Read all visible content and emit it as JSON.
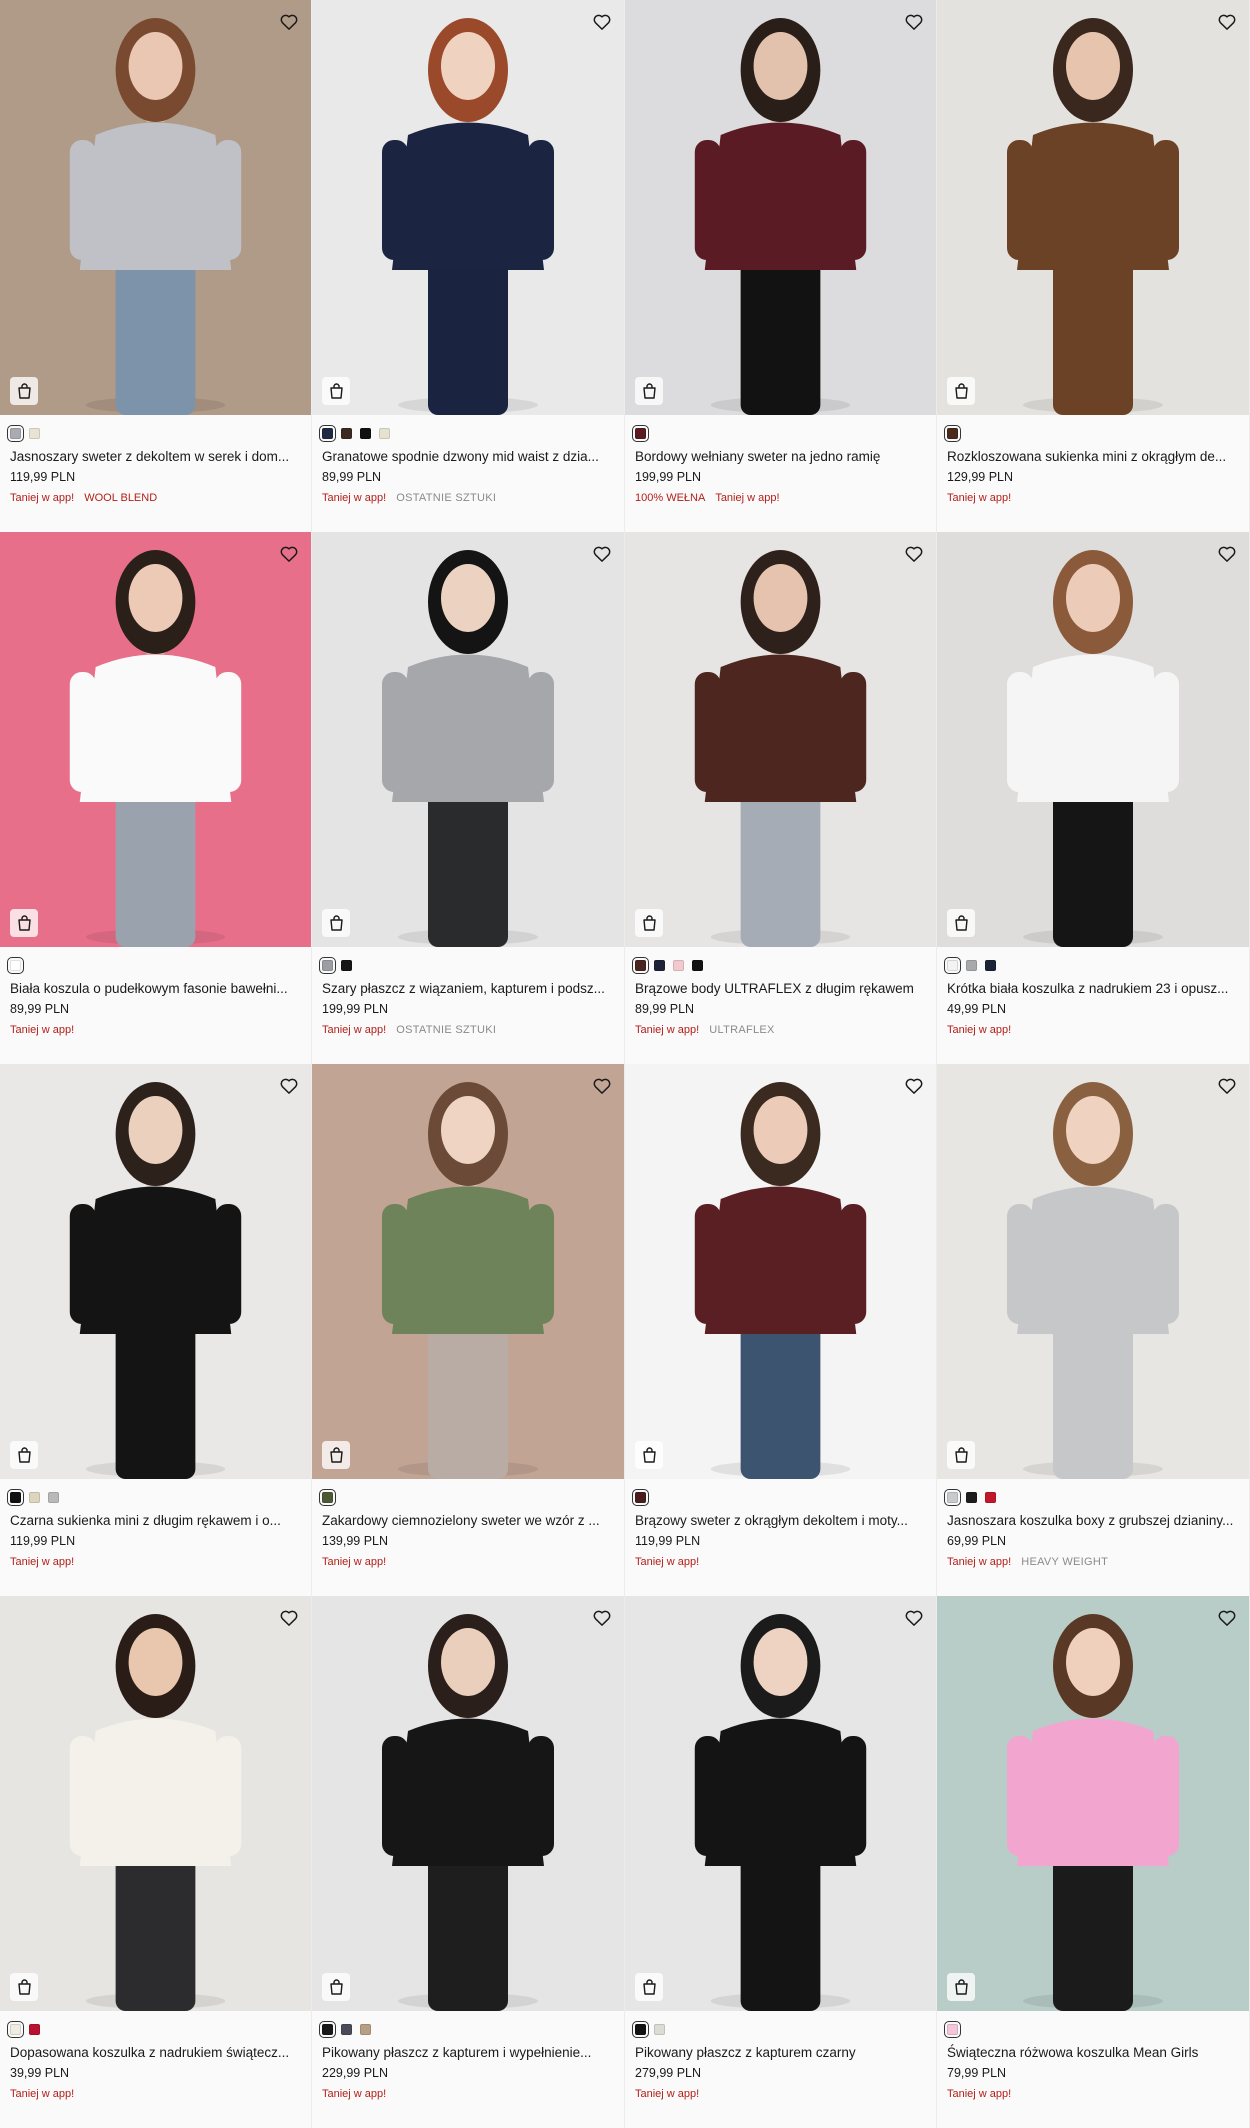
{
  "products": [
    {
      "name": "Jasnoszary sweter z dekoltem w serek i dom...",
      "price": "119,99 PLN",
      "tags": [
        {
          "text": "Taniej w app!",
          "style": "red"
        },
        {
          "text": "WOOL BLEND",
          "style": "red"
        }
      ],
      "swatches": [
        "#a9abb1",
        "#e8e3d3"
      ],
      "bg": "#b09a88",
      "top": "#bfc1c6",
      "bottom": "#7d93aa",
      "skin": "#e9c7b3",
      "hair": "#7a4a30"
    },
    {
      "name": "Granatowe spodnie dzwony mid waist z dzia...",
      "price": "89,99 PLN",
      "tags": [
        {
          "text": "Taniej w app!",
          "style": "red"
        },
        {
          "text": "OSTATNIE SZTUKI",
          "style": "grey"
        }
      ],
      "swatches": [
        "#1f2a44",
        "#3b2a22",
        "#111111",
        "#e6e2d0"
      ],
      "bg": "#e9e9ea",
      "top": "#1b2440",
      "bottom": "#1a2440",
      "skin": "#f0d2c0",
      "hair": "#9a4a2b"
    },
    {
      "name": "Bordowy wełniany sweter na jedno ramię",
      "price": "199,99 PLN",
      "tags": [
        {
          "text": "100% WEŁNA",
          "style": "red"
        },
        {
          "text": "Taniej w app!",
          "style": "red"
        }
      ],
      "swatches": [
        "#5a1a22"
      ],
      "bg": "#dcdcde",
      "top": "#5b1b24",
      "bottom": "#121212",
      "skin": "#e3c2ad",
      "hair": "#2a1e19"
    },
    {
      "name": "Rozkloszowana sukienka mini z okrągłym de...",
      "price": "129,99 PLN",
      "tags": [
        {
          "text": "Taniej w app!",
          "style": "red"
        }
      ],
      "swatches": [
        "#4a2a18"
      ],
      "bg": "#e3e2df",
      "top": "#6b4226",
      "bottom": "#6b4226",
      "skin": "#e6c4ae",
      "hair": "#3a271d"
    },
    {
      "name": "Biała koszula o pudełkowym fasonie bawełni...",
      "price": "89,99 PLN",
      "tags": [
        {
          "text": "Taniej w app!",
          "style": "red"
        }
      ],
      "swatches": [
        "#ffffff"
      ],
      "bg": "#e86f8a",
      "top": "#fafafa",
      "bottom": "#9aa3ad",
      "skin": "#eccab6",
      "hair": "#2b1f1a"
    },
    {
      "name": "Szary płaszcz z wiązaniem, kapturem i podsz...",
      "price": "199,99 PLN",
      "tags": [
        {
          "text": "Taniej w app!",
          "style": "red"
        },
        {
          "text": "OSTATNIE SZTUKI",
          "style": "grey"
        }
      ],
      "swatches": [
        "#9c9ea3",
        "#151515"
      ],
      "bg": "#e4e4e5",
      "top": "#a5a7ab",
      "bottom": "#2a2b2d",
      "skin": "#ecd2c0",
      "hair": "#141414"
    },
    {
      "name": "Brązowe body ULTRAFLEX z długim rękawem",
      "price": "89,99 PLN",
      "tags": [
        {
          "text": "Taniej w app!",
          "style": "red"
        },
        {
          "text": "ULTRAFLEX",
          "style": "grey"
        }
      ],
      "swatches": [
        "#4a2520",
        "#1e2238",
        "#f2c9cf",
        "#121212"
      ],
      "bg": "#e6e5e3",
      "top": "#4c261f",
      "bottom": "#a6acb5",
      "skin": "#e5c3ae",
      "hair": "#2e211b"
    },
    {
      "name": "Krótka biała koszulka z nadrukiem 23 i opusz...",
      "price": "49,99 PLN",
      "tags": [
        {
          "text": "Taniej w app!",
          "style": "red"
        }
      ],
      "swatches": [
        "#f3f3f3",
        "#a7a9aa",
        "#1b2436"
      ],
      "bg": "#dedddb",
      "top": "#f5f5f5",
      "bottom": "#151515",
      "skin": "#ecccb8",
      "hair": "#8a5a3a"
    },
    {
      "name": "Czarna sukienka mini z długim rękawem i o...",
      "price": "119,99 PLN",
      "tags": [
        {
          "text": "Taniej w app!",
          "style": "red"
        }
      ],
      "swatches": [
        "#111111",
        "#ddd5be",
        "#b9b9b9"
      ],
      "bg": "#e9e8e6",
      "top": "#141414",
      "bottom": "#141414",
      "skin": "#ecd0be",
      "hair": "#2d211b"
    },
    {
      "name": "Zakardowy ciemnozielony sweter we wzór z ...",
      "price": "139,99 PLN",
      "tags": [
        {
          "text": "Taniej w app!",
          "style": "red"
        }
      ],
      "swatches": [
        "#4e5a34"
      ],
      "bg": "#c2a494",
      "top": "#6e835a",
      "bottom": "#b9aca4",
      "skin": "#efd3c3",
      "hair": "#6b4a38"
    },
    {
      "name": "Brązowy sweter z okrągłym dekoltem i moty...",
      "price": "119,99 PLN",
      "tags": [
        {
          "text": "Taniej w app!",
          "style": "red"
        }
      ],
      "swatches": [
        "#4a1e1e"
      ],
      "bg": "#f4f4f4",
      "top": "#5a1f22",
      "bottom": "#3d5470",
      "skin": "#ecccb8",
      "hair": "#3b2a20"
    },
    {
      "name": "Jasnoszara koszulka boxy z grubszej dzianiny...",
      "price": "69,99 PLN",
      "tags": [
        {
          "text": "Taniej w app!",
          "style": "red"
        },
        {
          "text": "HEAVY WEIGHT",
          "style": "grey"
        }
      ],
      "swatches": [
        "#c9cacc",
        "#1c1c1c",
        "#c0182a"
      ],
      "bg": "#e8e6e2",
      "top": "#c6c7c9",
      "bottom": "#c6c7c9",
      "skin": "#efd2c0",
      "hair": "#8a6140"
    },
    {
      "name": "Dopasowana koszulka z nadrukiem świątecz...",
      "price": "39,99 PLN",
      "tags": [
        {
          "text": "Taniej w app!",
          "style": "red"
        }
      ],
      "swatches": [
        "#efece2",
        "#b8122e"
      ],
      "bg": "#e6e5e2",
      "top": "#f3f1ea",
      "bottom": "#2c2c2e",
      "skin": "#e9c6ae",
      "hair": "#2a1d17"
    },
    {
      "name": "Pikowany płaszcz z kapturem i wypełnienie...",
      "price": "229,99 PLN",
      "tags": [
        {
          "text": "Taniej w app!",
          "style": "red"
        }
      ],
      "swatches": [
        "#1a1a1a",
        "#4a4a58",
        "#b89e85"
      ],
      "bg": "#e5e5e5",
      "top": "#161616",
      "bottom": "#1e1e1e",
      "skin": "#ebcfbd",
      "hair": "#2a1f1a"
    },
    {
      "name": "Pikowany płaszcz z kapturem czarny",
      "price": "279,99 PLN",
      "tags": [
        {
          "text": "Taniej w app!",
          "style": "red"
        }
      ],
      "swatches": [
        "#131313",
        "#dcdcd4"
      ],
      "bg": "#e6e6e6",
      "top": "#141414",
      "bottom": "#141414",
      "skin": "#eed3c2",
      "hair": "#1b1b1b"
    },
    {
      "name": "Świąteczna różwowa koszulka Mean Girls",
      "price": "79,99 PLN",
      "tags": [
        {
          "text": "Taniej w app!",
          "style": "red"
        }
      ],
      "swatches": [
        "#f5c6da"
      ],
      "bg": "#b8ccc8",
      "top": "#f2a6cf",
      "bottom": "#1b1b1b",
      "skin": "#efd0bd",
      "hair": "#5a3826"
    }
  ],
  "icons": {
    "favorite": "heart-icon",
    "add_to_cart": "shopping-bag-icon"
  },
  "colors": {
    "promo": "#b3201b",
    "tag_grey": "#8a8a8a"
  }
}
